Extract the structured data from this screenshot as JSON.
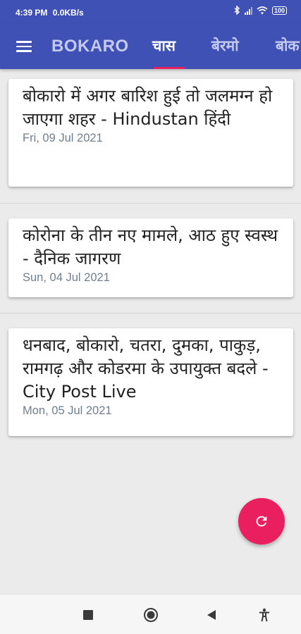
{
  "status_bar": {
    "time": "4:39 PM",
    "speed": "0.0KB/s",
    "battery": "100"
  },
  "app_bar": {
    "title": "BOKARO",
    "tabs": [
      {
        "label": "चास",
        "active": true
      },
      {
        "label": "बेरमो",
        "active": false
      },
      {
        "label": "बोक",
        "active": false
      }
    ]
  },
  "articles": [
    {
      "title": "बोकारो में अगर बारिश हुई तो जलमग्न हो जाएगा शहर - Hindustan हिंदी",
      "date": "Fri, 09 Jul 2021"
    },
    {
      "title": "कोरोना के तीन नए मामले, आठ हुए स्वस्थ - दैनिक जागरण",
      "date": "Sun, 04 Jul 2021"
    },
    {
      "title": "धनबाद, बोकारो, चतरा, दुमका, पाकुड़, रामगढ़ और कोडरमा के उपायुक्त बदले - City Post Live",
      "date": "Mon, 05 Jul 2021"
    }
  ],
  "colors": {
    "primary": "#3f51b5",
    "accent": "#e91e63",
    "fab": "#ea1f5f",
    "background": "#ebebeb",
    "date_text": "#6f7f8e"
  },
  "icons": {
    "menu": "menu-icon",
    "fab": "refresh-icon",
    "nav": [
      "recent-apps-icon",
      "home-icon",
      "back-icon",
      "accessibility-icon"
    ]
  }
}
